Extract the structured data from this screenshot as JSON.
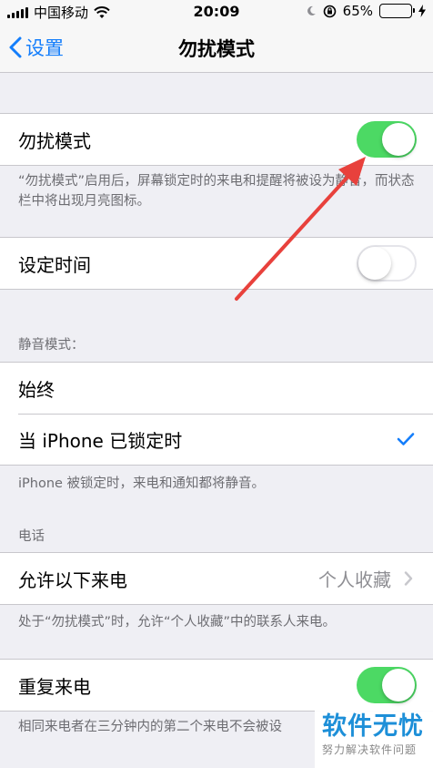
{
  "status_bar": {
    "carrier": "中国移动",
    "time": "20:09",
    "battery_percent": "65%",
    "battery_level": 0.65
  },
  "nav": {
    "back_label": "设置",
    "title": "勿扰模式"
  },
  "dnd": {
    "label": "勿扰模式",
    "enabled": true,
    "footer": "“勿扰模式”启用后，屏幕锁定时的来电和提醒将被设为静音，而状态栏中将出现月亮图标。"
  },
  "scheduled": {
    "label": "设定时间",
    "enabled": false
  },
  "silence": {
    "header": "静音模式：",
    "options": [
      {
        "label": "始终",
        "selected": false
      },
      {
        "label": "当 iPhone 已锁定时",
        "selected": true
      }
    ],
    "footer": "iPhone 被锁定时，来电和通知都将静音。"
  },
  "phone": {
    "header": "电话",
    "allow_calls_label": "允许以下来电",
    "allow_calls_value": "个人收藏",
    "footer": "处于“勿扰模式”时，允许“个人收藏”中的联系人来电。"
  },
  "repeated": {
    "label": "重复来电",
    "enabled": true,
    "footer": "相同来电者在三分钟内的第二个来电不会被设"
  },
  "watermark": {
    "title": "软件无忧",
    "subtitle": "努力解决软件问题"
  },
  "colors": {
    "accent": "#147efb",
    "toggle_on": "#4cd964",
    "annotation_arrow": "#e8413c"
  }
}
